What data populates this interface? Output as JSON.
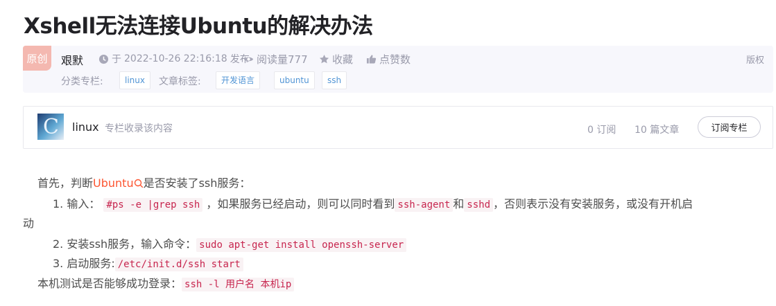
{
  "article": {
    "title": "Xshell无法连接Ubuntu的解决办法",
    "badge": "原创",
    "author": "艰默",
    "publish_prefix": "于",
    "publish_time": "2022-10-26 22:16:18",
    "publish_suffix": "发布",
    "read_count": "阅读量777",
    "collect_label": "收藏",
    "like_label": "点赞数",
    "copyright_label": "版权",
    "category_label": "分类专栏:",
    "category_tag": "linux",
    "tags_label": "文章标签:",
    "tags": [
      "开发语言",
      "ubuntu",
      "ssh"
    ]
  },
  "column": {
    "avatar_letter": "C",
    "name": "linux",
    "desc": "专栏收录该内容",
    "subscribers": "0 订阅",
    "articles": "10 篇文章",
    "subscribe_label": "订阅专栏"
  },
  "content": {
    "line1_prefix": "首先，判断",
    "line1_link": "Ubuntu",
    "line1_suffix": "是否安装了ssh服务：",
    "step1_prefix": "1. 输入：",
    "step1_code": "#ps -e |grep ssh",
    "step1_mid": "，如果服务已经启动，则可以同时看到",
    "step1_code2": "ssh-agent",
    "step1_and": "和",
    "step1_code3": "sshd",
    "step1_suffix": "，否则表示没有安装服务，或没有开机启",
    "step1_wrap": "动",
    "step2_prefix": "2. 安装ssh服务，输入命令：",
    "step2_code": "sudo apt-get install openssh-server",
    "step3_prefix": "3. 启动服务:",
    "step3_code": "/etc/init.d/ssh start",
    "line5_prefix": "本机测试是否能够成功登录：",
    "line5_code": "ssh -l 用户名 本机ip"
  },
  "colors": {
    "link": "#fc5531",
    "tag_text": "#5094d5",
    "badge_bg": "#f4b8b0",
    "code_text": "#c7254e",
    "code_bg": "#f9f2f4"
  },
  "icons": [
    "clock-icon",
    "eye-icon",
    "star-icon",
    "thumbs-up-icon",
    "search-icon"
  ]
}
